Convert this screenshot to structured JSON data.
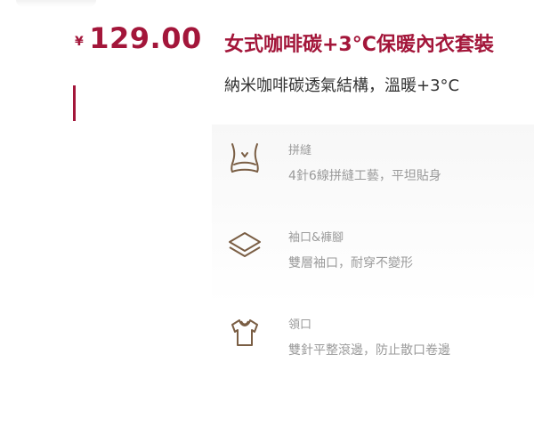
{
  "theme": {
    "accent": "#a3163a",
    "icon_color": "#7a5e44",
    "muted_text": "#9a9a9a",
    "body_text": "#333333"
  },
  "price": {
    "currency_symbol": "¥",
    "amount": "129.00"
  },
  "product": {
    "title": "女式咖啡碳+3°C保暖內衣套裝",
    "subtitle": "納米咖啡碳透氣結構，溫暖+3°C"
  },
  "features": [
    {
      "icon": "waist-seam-icon",
      "title": "拼縫",
      "description": "4針6線拼縫工藝，平坦貼身"
    },
    {
      "icon": "layers-icon",
      "title": "袖口&褲腳",
      "description": "雙層袖口，耐穿不變形"
    },
    {
      "icon": "tshirt-collar-icon",
      "title": "領口",
      "description": "雙針平整滾邊，防止散口卷邊"
    }
  ]
}
